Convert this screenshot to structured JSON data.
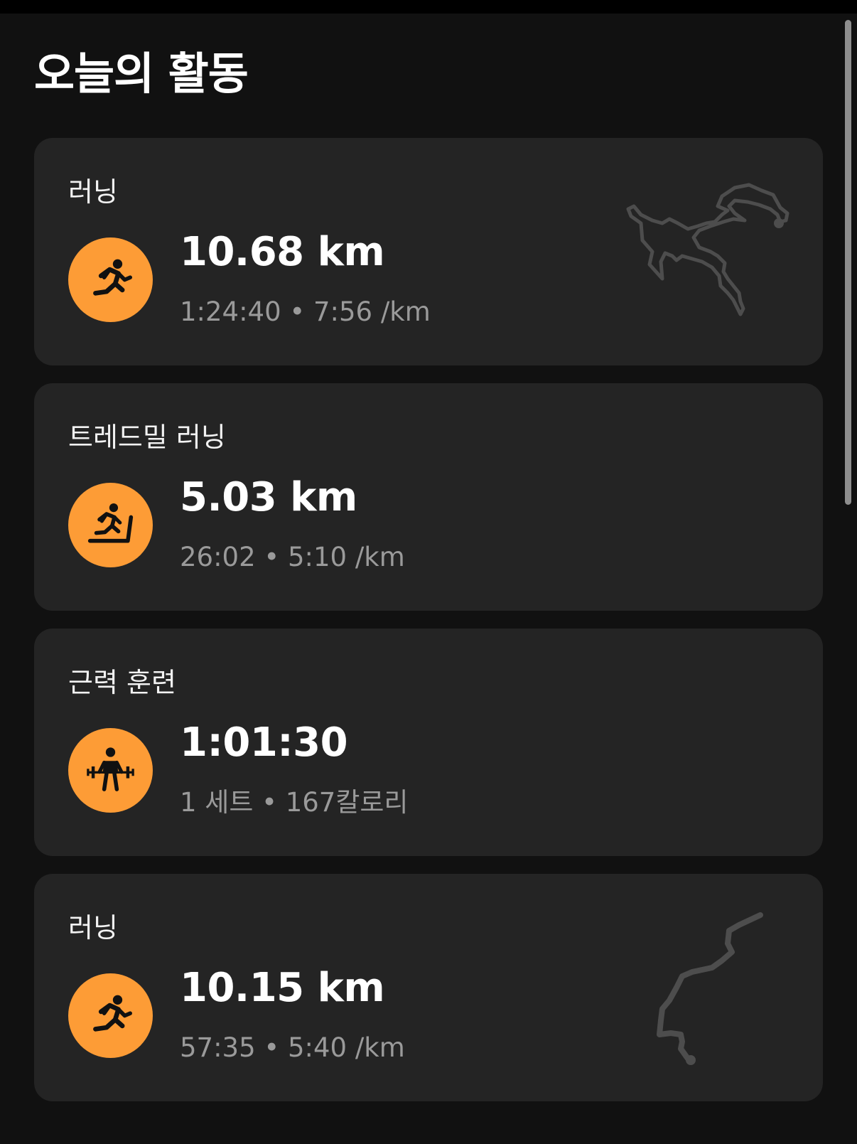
{
  "page": {
    "title": "오늘의 활동"
  },
  "activities": [
    {
      "type": "러닝",
      "icon": "running-icon",
      "metric": "10.68 km",
      "detail": "1:24:40 • 7:56 /km",
      "has_route_map": true
    },
    {
      "type": "트레드밀 러닝",
      "icon": "treadmill-running-icon",
      "metric": "5.03 km",
      "detail": "26:02 • 5:10 /km",
      "has_route_map": false
    },
    {
      "type": "근력 훈련",
      "icon": "strength-training-icon",
      "metric": "1:01:30",
      "detail": "1 세트 • 167칼로리",
      "has_route_map": false
    },
    {
      "type": "러닝",
      "icon": "running-icon",
      "metric": "10.15 km",
      "detail": "57:35 • 5:40 /km",
      "has_route_map": true
    }
  ],
  "colors": {
    "background": "#111111",
    "card": "#242424",
    "accent": "#fd9c36",
    "secondary_text": "#9a9a9a",
    "route": "#4d4d4d"
  }
}
